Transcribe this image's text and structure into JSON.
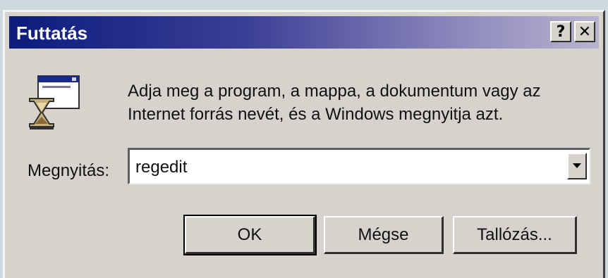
{
  "window": {
    "title": "Futtatás",
    "help_label": "?",
    "close_label": "✕"
  },
  "icon": "run-program-icon",
  "prompt": {
    "line1": "Adja meg a program, a mappa, a dokumentum vagy az",
    "line2": "Internet forrás nevét, és a Windows megnyitja azt."
  },
  "open": {
    "label": "Megnyitás:",
    "value": "regedit",
    "arrow_icon": "chevron-down-icon"
  },
  "buttons": {
    "ok": "OK",
    "cancel": "Mégse",
    "browse": "Tallózás..."
  },
  "colors": {
    "title_start": "#0b1c7d",
    "title_end": "#b8b4cf",
    "face": "#d6d3cd"
  }
}
